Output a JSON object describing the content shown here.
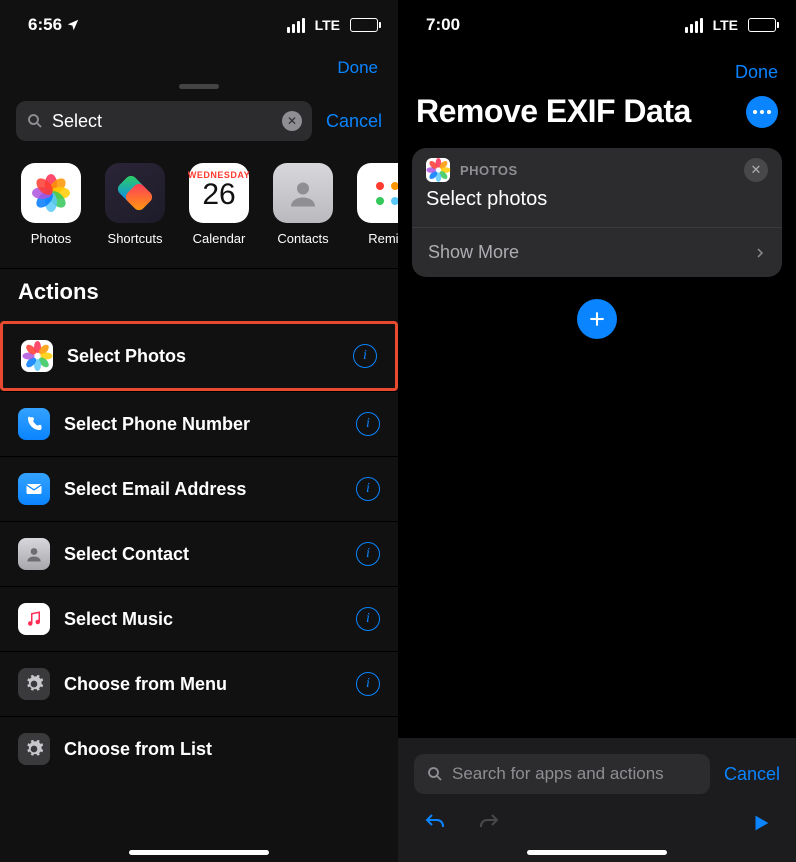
{
  "left": {
    "time": "6:56",
    "network": "LTE",
    "done": "Done",
    "search_value": "Select",
    "cancel": "Cancel",
    "apps": {
      "photos": "Photos",
      "shortcuts": "Shortcuts",
      "calendar": "Calendar",
      "cal_day": "Wednesday",
      "cal_num": "26",
      "contacts": "Contacts",
      "reminders": "Remin"
    },
    "actions_header": "Actions",
    "actions": [
      {
        "label": "Select Photos"
      },
      {
        "label": "Select Phone Number"
      },
      {
        "label": "Select Email Address"
      },
      {
        "label": "Select Contact"
      },
      {
        "label": "Select Music"
      },
      {
        "label": "Choose from Menu"
      },
      {
        "label": "Choose from List"
      }
    ]
  },
  "right": {
    "time": "7:00",
    "network": "LTE",
    "done": "Done",
    "title": "Remove EXIF Data",
    "card_app": "PHOTOS",
    "card_title": "Select photos",
    "show_more": "Show More",
    "search_placeholder": "Search for apps and actions",
    "cancel": "Cancel"
  }
}
